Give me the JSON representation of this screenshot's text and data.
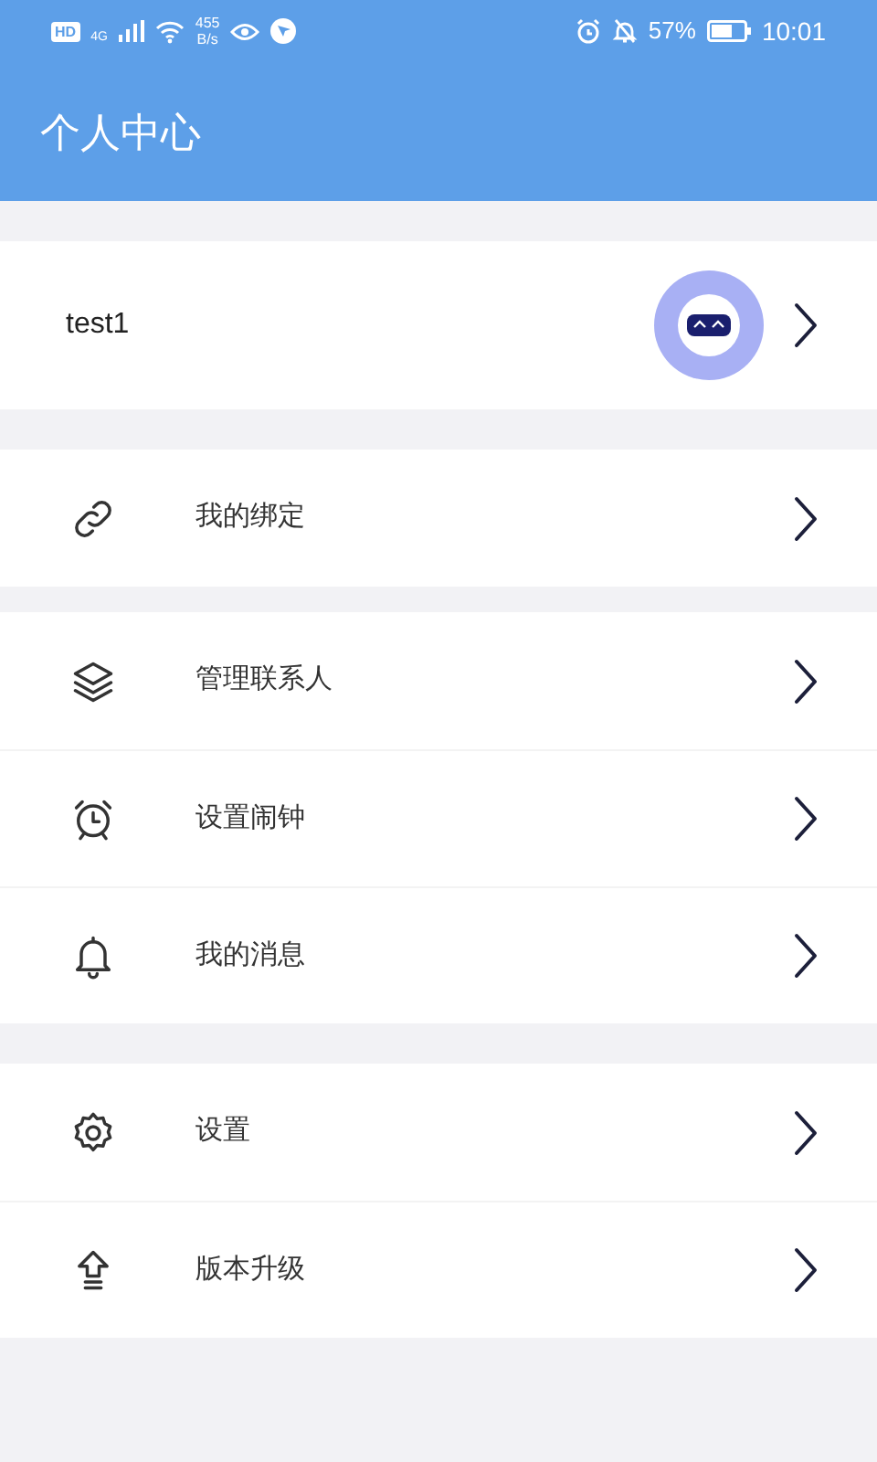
{
  "status_bar": {
    "hd": "HD",
    "network": "4G",
    "speed_value": "455",
    "speed_unit": "B/s",
    "battery": "57%",
    "time": "10:01"
  },
  "header": {
    "title": "个人中心"
  },
  "profile": {
    "username": "test1"
  },
  "menu_groups": [
    [
      {
        "label": "我的绑定"
      }
    ],
    [
      {
        "label": "管理联系人"
      },
      {
        "label": "设置闹钟"
      },
      {
        "label": "我的消息"
      }
    ],
    [
      {
        "label": "设置"
      },
      {
        "label": "版本升级"
      }
    ]
  ]
}
